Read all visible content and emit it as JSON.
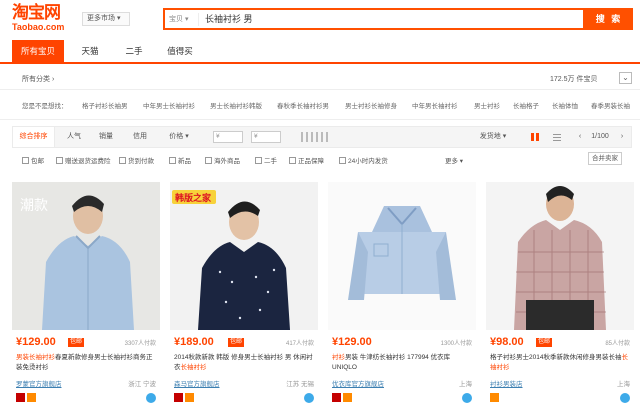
{
  "header": {
    "logo_cn": "淘宝网",
    "logo_en": "Taobao.com",
    "market_label": "更多市场",
    "search_scope": "宝贝",
    "search_query": "长袖衬衫 男",
    "search_button": "搜 索"
  },
  "tabs": [
    {
      "label": "所有宝贝"
    },
    {
      "label": "天猫"
    },
    {
      "label": "二手"
    },
    {
      "label": "值得买"
    }
  ],
  "breadcrumb": {
    "label": "所有分类",
    "count": "172.5万 件宝贝"
  },
  "related": {
    "label": "您是不是想找：",
    "items": [
      "格子衬衫长袖男",
      "中年男士长袖衬衫",
      "男士长袖衬衫韩版",
      "春秋季长袖衬衫男",
      "男士衬衫长袖修身",
      "中年男长袖衬衫",
      "男士衬衫",
      "长袖格子",
      "长袖体恤",
      "春季男装长袖"
    ]
  },
  "sort": {
    "items": [
      "综合排序",
      "人气",
      "销量",
      "信用",
      "价格"
    ],
    "price_from": "¥",
    "price_to": "¥",
    "delivery": "发货地",
    "page": "1/100"
  },
  "filters": {
    "items": [
      "包邮",
      "赠送退货运费险",
      "货到付款",
      "新品",
      "海外商品",
      "二手",
      "正品保障",
      "24小时内发货"
    ],
    "more": "更多",
    "merge": "合并卖家"
  },
  "products": [
    {
      "price": "¥129.00",
      "ship": "包邮",
      "sales": "3307人付款",
      "title_hl": "男装长袖衬衫",
      "title": "春夏新款修身男士长袖衬衫商务正装免烫衬衫",
      "shop": "罗蒙官方旗舰店",
      "loc": "浙江 宁波",
      "img_text": "潮款"
    },
    {
      "price": "¥189.00",
      "ship": "包邮",
      "sales": "417人付款",
      "title_hl": "长袖衬衫",
      "title": "2014秋款新款 韩版 修身男士长袖衬衫 男 休闲衬衣",
      "shop": "森马官方旗舰店",
      "loc": "江苏 无锡",
      "img_text": "韩版之家"
    },
    {
      "price": "¥129.00",
      "ship": "包邮",
      "sales": "1300人付款",
      "title_hl": "衬衫",
      "title": "男装 牛津纺长袖衬衫 177994 优衣库UNIQLO",
      "shop": "优衣库官方旗舰店",
      "loc": "上海",
      "img_text": ""
    },
    {
      "price": "¥98.00",
      "ship": "包邮",
      "sales": "85人付款",
      "title_hl": "长袖衬衫",
      "title": "格子衬衫男士2014秋季新款休闲修身男装长袖",
      "shop": "衬衫男装店",
      "loc": "上海",
      "img_text": ""
    }
  ],
  "colors": {
    "accent": "#ff4400",
    "link": "#3c7fb1"
  }
}
